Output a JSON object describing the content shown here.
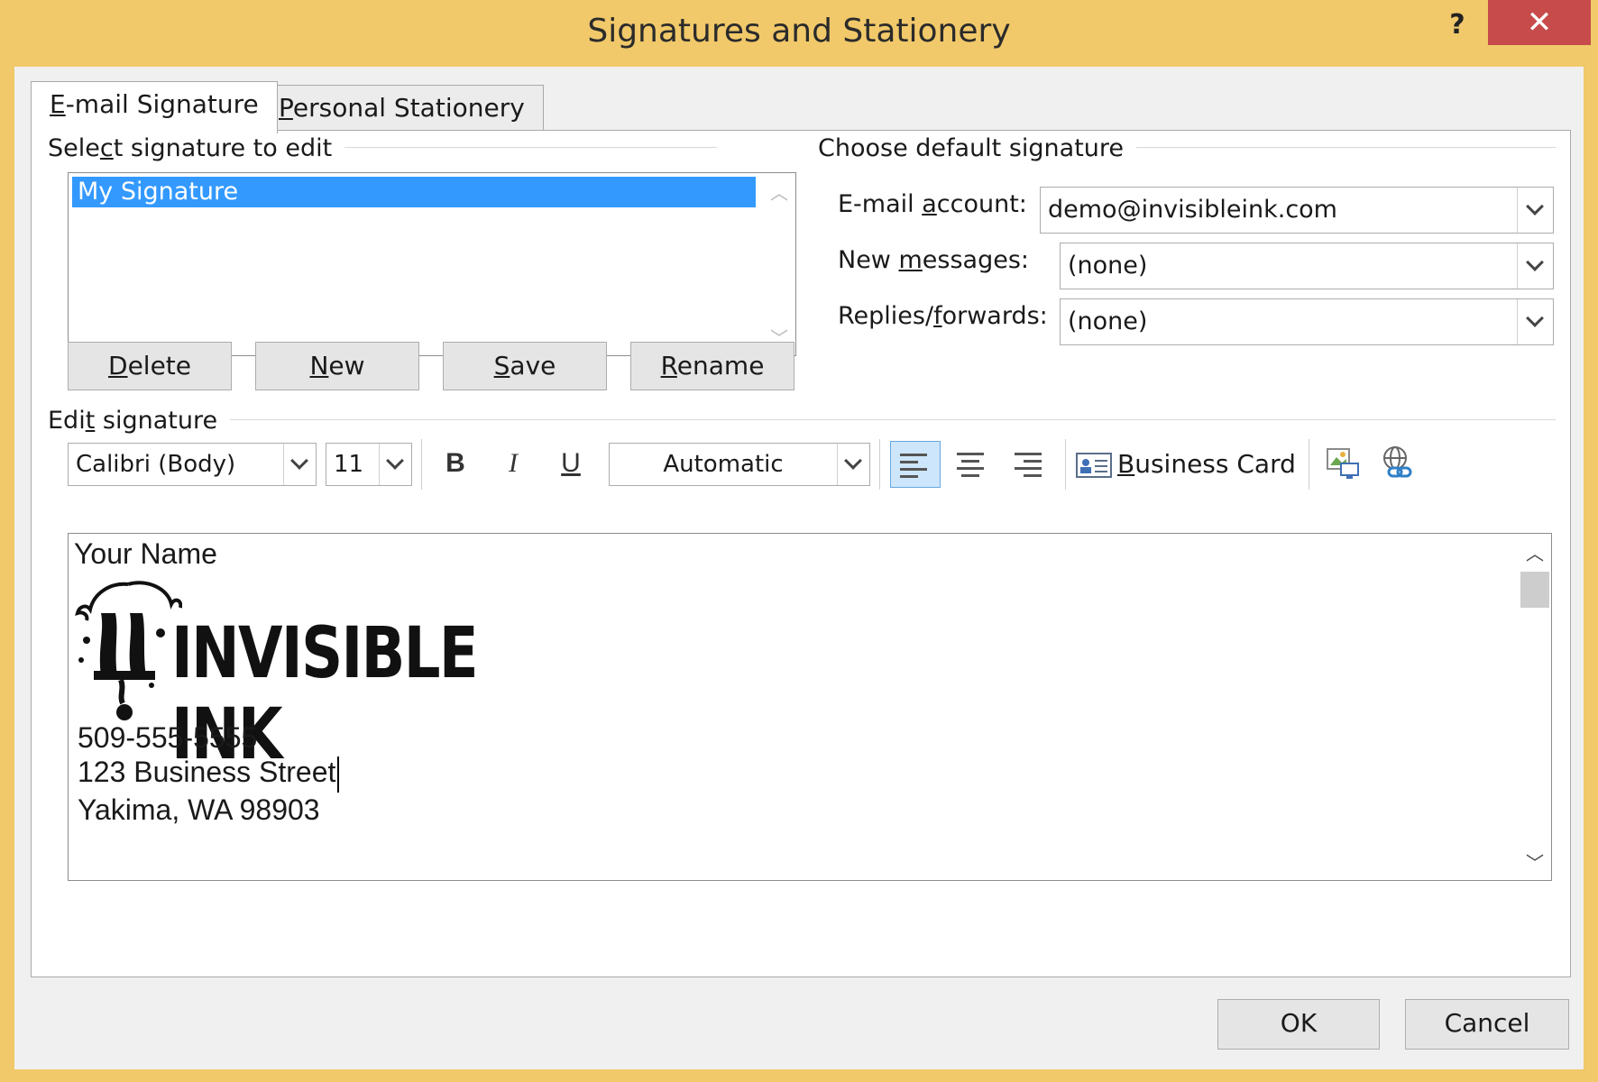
{
  "window": {
    "title": "Signatures and Stationery",
    "help_label": "?",
    "close_label": "✕"
  },
  "tabs": [
    {
      "label_ul": "E",
      "label_rest": "-mail Signature"
    },
    {
      "label_ul": "P",
      "label_rest": "ersonal Stationery"
    }
  ],
  "select_group": {
    "title_pre": "Sele",
    "title_ul": "c",
    "title_post": "t signature to edit",
    "items": [
      "My Signature"
    ]
  },
  "buttons": {
    "delete": {
      "ul": "D",
      "rest": "elete"
    },
    "new": {
      "ul": "N",
      "rest": "ew"
    },
    "save": {
      "ul": "S",
      "rest": "ave"
    },
    "rename": {
      "ul": "R",
      "rest": "ename"
    }
  },
  "default_group": {
    "title": "Choose default signature",
    "email_label_pre": "E-mail ",
    "email_label_ul": "a",
    "email_label_post": "ccount:",
    "email_value": "demo@invisibleink.com",
    "new_label_pre": "New ",
    "new_label_ul": "m",
    "new_label_post": "essages:",
    "new_value": "(none)",
    "replies_label_pre": "Replies/",
    "replies_label_ul": "f",
    "replies_label_post": "orwards:",
    "replies_value": "(none)"
  },
  "edit_group": {
    "title_pre": "Edi",
    "title_ul": "t",
    "title_post": " signature"
  },
  "toolbar": {
    "font": "Calibri (Body)",
    "size": "11",
    "bold": "B",
    "italic": "I",
    "underline": "U",
    "color": "Automatic",
    "business_card_ul": "B",
    "business_card_rest": "usiness Card"
  },
  "signature": {
    "name": "Your Name",
    "logo_text": "INVISIBLE INK",
    "phone": "509-555-5555",
    "street": "123 Business Street",
    "city": "Yakima, WA 98903"
  },
  "footer": {
    "ok": "OK",
    "cancel": "Cancel"
  },
  "colors": {
    "frame": "#f1c96a",
    "close": "#c74b4b",
    "selection": "#3399ff"
  }
}
